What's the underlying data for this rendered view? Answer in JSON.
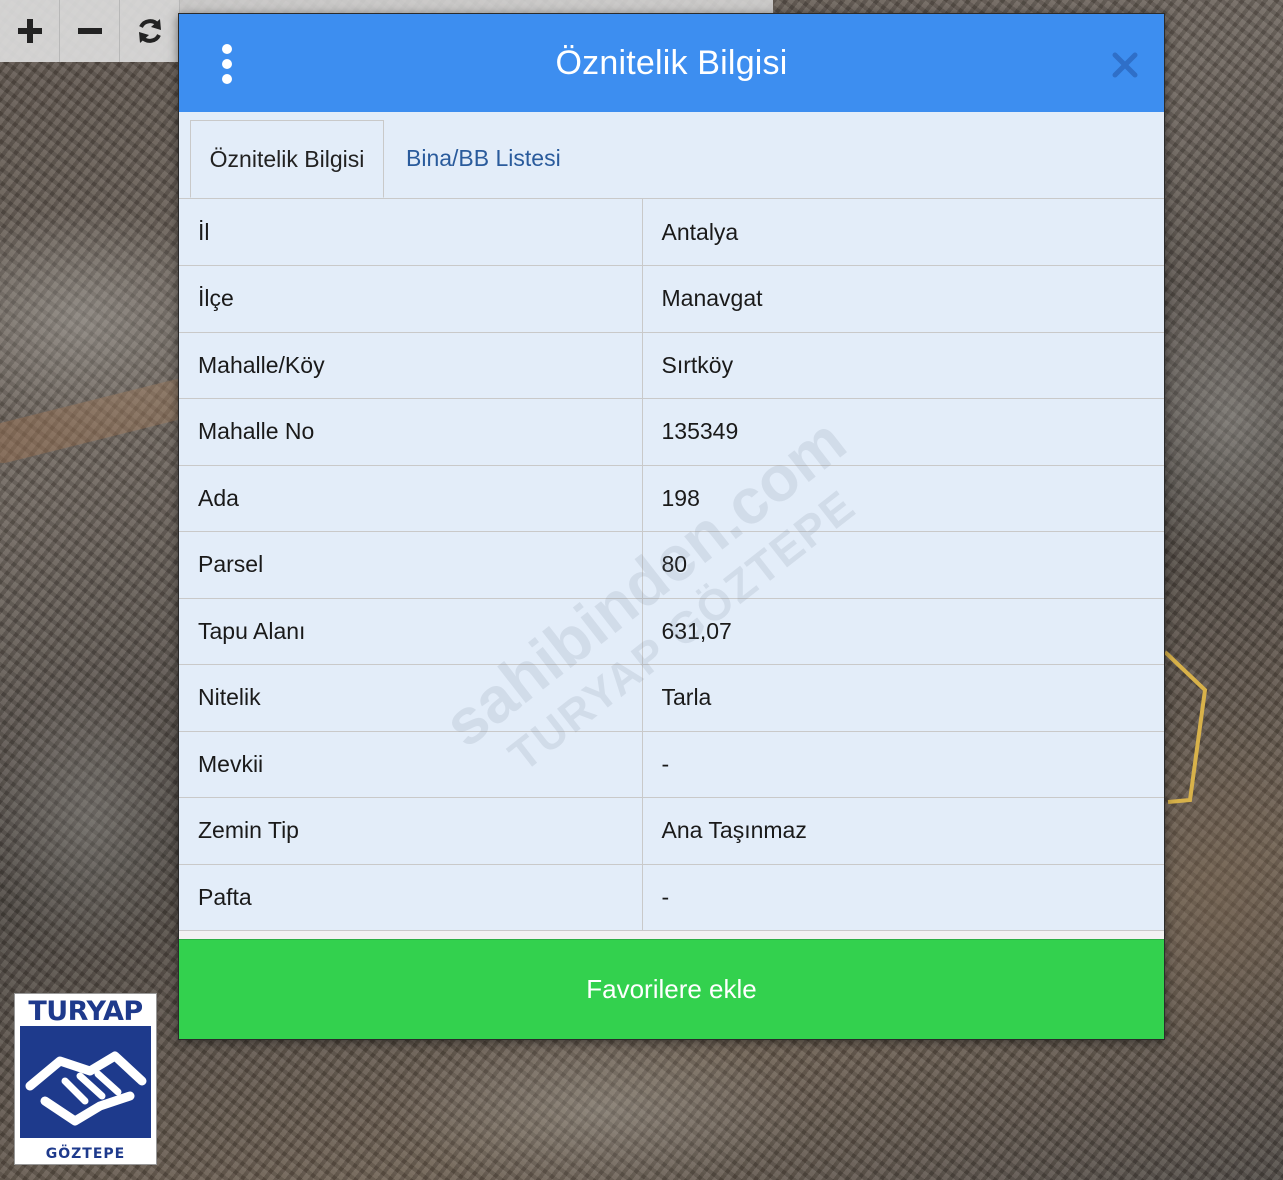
{
  "map": {
    "zoom_in_label": "+",
    "zoom_out_label": "−",
    "refresh_icon": "refresh-icon"
  },
  "dialog": {
    "title": "Öznitelik Bilgisi",
    "menu_icon": "vertical-dots-icon",
    "close_icon": "close-icon",
    "header_color": "#3d8ef0",
    "tabs": [
      {
        "label": "Öznitelik Bilgisi",
        "active": true
      },
      {
        "label": "Bina/BB Listesi",
        "active": false
      }
    ],
    "rows": [
      {
        "key": "İl",
        "value": "Antalya"
      },
      {
        "key": "İlçe",
        "value": "Manavgat"
      },
      {
        "key": "Mahalle/Köy",
        "value": "Sırtköy"
      },
      {
        "key": "Mahalle No",
        "value": "135349"
      },
      {
        "key": "Ada",
        "value": "198"
      },
      {
        "key": "Parsel",
        "value": "80"
      },
      {
        "key": "Tapu Alanı",
        "value": "631,07"
      },
      {
        "key": "Nitelik",
        "value": "Tarla"
      },
      {
        "key": "Mevkii",
        "value": "-"
      },
      {
        "key": "Zemin Tip",
        "value": "Ana Taşınmaz"
      },
      {
        "key": "Pafta",
        "value": "-"
      }
    ],
    "favorite_button": "Favorilere ekle",
    "favorite_color": "#33d14e"
  },
  "watermark": {
    "line1": "sahibinden.com",
    "line2": "TURYAP GÖZTEPE"
  },
  "logo": {
    "brand": "TURYAP",
    "sub": "GÖZTEPE"
  }
}
